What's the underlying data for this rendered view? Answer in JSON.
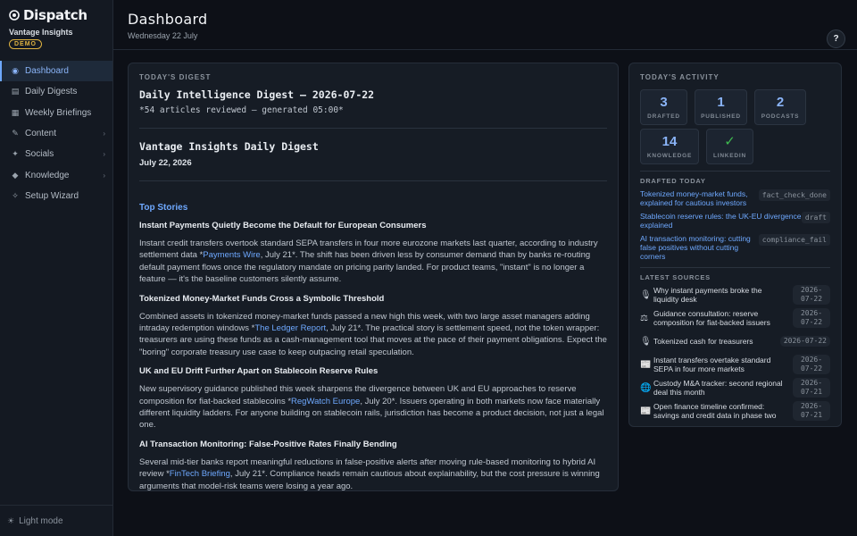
{
  "brand": {
    "name": "Dispatch",
    "org": "Vantage Insights",
    "badge": "DEMO"
  },
  "nav": [
    {
      "label": "Dashboard",
      "icon": "◉",
      "active": true,
      "chev": ""
    },
    {
      "label": "Daily Digests",
      "icon": "▤",
      "active": false,
      "chev": ""
    },
    {
      "label": "Weekly Briefings",
      "icon": "▦",
      "active": false,
      "chev": ""
    },
    {
      "label": "Content",
      "icon": "✎",
      "active": false,
      "chev": "›"
    },
    {
      "label": "Socials",
      "icon": "✦",
      "active": false,
      "chev": "›"
    },
    {
      "label": "Knowledge",
      "icon": "◆",
      "active": false,
      "chev": "›"
    },
    {
      "label": "Setup Wizard",
      "icon": "✧",
      "active": false,
      "chev": ""
    }
  ],
  "footer": {
    "label": "Light mode",
    "icon": "☀"
  },
  "header": {
    "title": "Dashboard",
    "date": "Wednesday 22 July",
    "help": "?"
  },
  "digest": {
    "label": "TODAY'S DIGEST",
    "title": "Daily Intelligence Digest — 2026-07-22",
    "subtitle": "*54 articles reviewed — generated 05:00*",
    "heading": "Vantage Insights Daily Digest",
    "date": "July 22, 2026",
    "section": "Top Stories",
    "stories": [
      {
        "title": "Instant Payments Quietly Become the Default for European Consumers",
        "pre": "Instant credit transfers overtook standard SEPA transfers in four more eurozone markets last quarter, according to industry settlement data *",
        "source": "Payments Wire",
        "post": ", July 21*. The shift has been driven less by consumer demand than by banks re-routing default payment flows once the regulatory mandate on pricing parity landed. For product teams, \"instant\" is no longer a feature — it's the baseline customers silently assume."
      },
      {
        "title": "Tokenized Money-Market Funds Cross a Symbolic Threshold",
        "pre": "Combined assets in tokenized money-market funds passed a new high this week, with two large asset managers adding intraday redemption windows *",
        "source": "The Ledger Report",
        "post": ", July 21*. The practical story is settlement speed, not the token wrapper: treasurers are using these funds as a cash-management tool that moves at the pace of their payment obligations. Expect the \"boring\" corporate treasury use case to keep outpacing retail speculation."
      },
      {
        "title": "UK and EU Drift Further Apart on Stablecoin Reserve Rules",
        "pre": "New supervisory guidance published this week sharpens the divergence between UK and EU approaches to reserve composition for fiat-backed stablecoins *",
        "source": "RegWatch Europe",
        "post": ", July 20*. Issuers operating in both markets now face materially different liquidity ladders. For anyone building on stablecoin rails, jurisdiction has become a product decision, not just a legal one."
      },
      {
        "title": "AI Transaction Monitoring: False-Positive Rates Finally Bending",
        "pre": "Several mid-tier banks report meaningful reductions in false-positive alerts after moving rule-based monitoring to hybrid AI review *",
        "source": "FinTech Briefing",
        "post": ", July 21*. Compliance heads remain cautious about explainability, but the cost pressure is winning arguments that model-risk teams were losing a year ago."
      }
    ]
  },
  "activity": {
    "label": "TODAY'S ACTIVITY",
    "stats": [
      {
        "value": "3",
        "label": "DRAFTED"
      },
      {
        "value": "1",
        "label": "PUBLISHED"
      },
      {
        "value": "2",
        "label": "PODCASTS"
      },
      {
        "value": "14",
        "label": "KNOWLEDGE"
      },
      {
        "value": "✓",
        "label": "LINKEDIN"
      }
    ],
    "drafted_label": "DRAFTED TODAY",
    "drafted": [
      {
        "title": "Tokenized money-market funds, explained for cautious investors",
        "status": "fact_check_done"
      },
      {
        "title": "Stablecoin reserve rules: the UK-EU divergence explained",
        "status": "draft"
      },
      {
        "title": "AI transaction monitoring: cutting false positives without cutting corners",
        "status": "compliance_fail"
      }
    ],
    "sources_label": "LATEST SOURCES",
    "sources": [
      {
        "icon": "🎙",
        "title": "Why instant payments broke the liquidity desk",
        "date": "2026-07-22"
      },
      {
        "icon": "⚖",
        "title": "Guidance consultation: reserve composition for fiat-backed issuers",
        "date": "2026-07-22"
      },
      {
        "icon": "🎙",
        "title": "Tokenized cash for treasurers",
        "date": "2026-07-22"
      },
      {
        "icon": "📰",
        "title": "Instant transfers overtake standard SEPA in four more markets",
        "date": "2026-07-22"
      },
      {
        "icon": "🌐",
        "title": "Custody M&A tracker: second regional deal this month",
        "date": "2026-07-21"
      },
      {
        "icon": "📰",
        "title": "Open finance timeline confirmed: savings and credit data in phase two",
        "date": "2026-07-21"
      }
    ]
  }
}
